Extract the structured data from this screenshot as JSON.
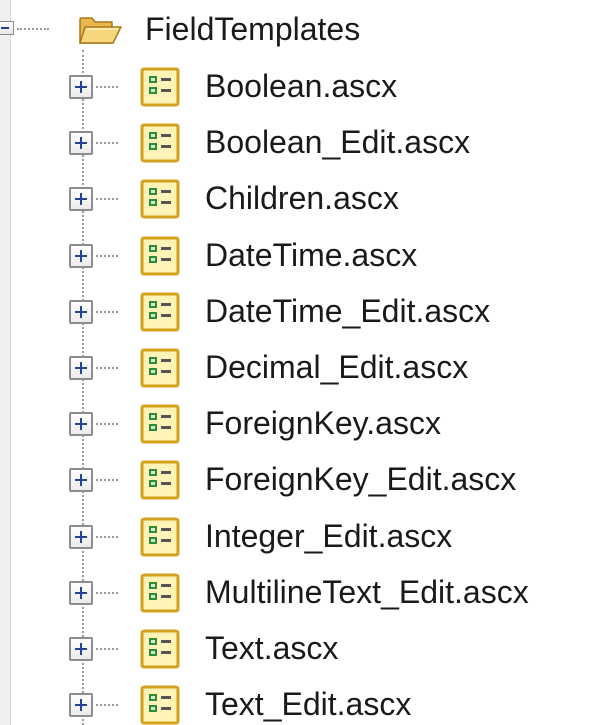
{
  "tree": {
    "root": {
      "label": "FieldTemplates",
      "icon": "folder-open-icon",
      "expanded": true
    },
    "items": [
      {
        "label": "Boolean.ascx",
        "icon": "user-control-icon"
      },
      {
        "label": "Boolean_Edit.ascx",
        "icon": "user-control-icon"
      },
      {
        "label": "Children.ascx",
        "icon": "user-control-icon"
      },
      {
        "label": "DateTime.ascx",
        "icon": "user-control-icon"
      },
      {
        "label": "DateTime_Edit.ascx",
        "icon": "user-control-icon"
      },
      {
        "label": "Decimal_Edit.ascx",
        "icon": "user-control-icon"
      },
      {
        "label": "ForeignKey.ascx",
        "icon": "user-control-icon"
      },
      {
        "label": "ForeignKey_Edit.ascx",
        "icon": "user-control-icon"
      },
      {
        "label": "Integer_Edit.ascx",
        "icon": "user-control-icon"
      },
      {
        "label": "MultilineText_Edit.ascx",
        "icon": "user-control-icon"
      },
      {
        "label": "Text.ascx",
        "icon": "user-control-icon"
      },
      {
        "label": "Text_Edit.ascx",
        "icon": "user-control-icon"
      }
    ]
  },
  "colors": {
    "icon_border": "#d3a21c",
    "icon_fill": "#fff3b8",
    "icon_green": "#2f8b3a",
    "expander_sign": "#22439a",
    "text": "#1a1a1a"
  }
}
